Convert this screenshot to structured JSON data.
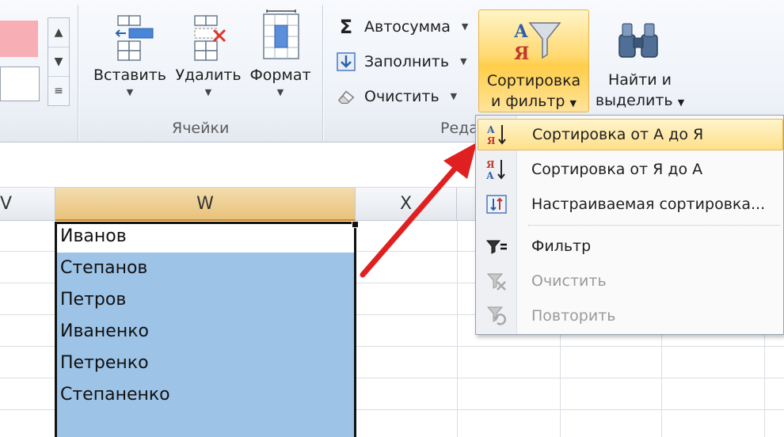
{
  "ribbon": {
    "cells_group": {
      "label": "Ячейки",
      "insert_label": "Вставить",
      "delete_label": "Удалить",
      "format_label": "Формат"
    },
    "editing_group": {
      "label_partial": "Реда",
      "autosum_label": "Автосумма",
      "fill_label": "Заполнить",
      "clear_label": "Очистить",
      "sort_label_line1": "Сортировка",
      "sort_label_line2": "и фильтр",
      "find_label_line1": "Найти и",
      "find_label_line2": "выделить"
    }
  },
  "grid": {
    "columns": [
      "V",
      "W",
      "X"
    ],
    "cells": [
      "Иванов",
      "Степанов",
      "Петров",
      "Иваненко",
      "Петренко",
      "Степаненко"
    ]
  },
  "sort_menu": {
    "items": [
      {
        "label": "Сортировка от А до Я",
        "icon": "sort-a-to-z-icon",
        "state": "hover"
      },
      {
        "label": "Сортировка от Я до А",
        "icon": "sort-z-to-a-icon",
        "state": "normal"
      },
      {
        "label": "Настраиваемая сортировка...",
        "icon": "custom-sort-icon",
        "state": "normal"
      },
      {
        "label": "Фильтр",
        "icon": "filter-icon",
        "state": "normal"
      },
      {
        "label": "Очистить",
        "icon": "clear-filter-icon",
        "state": "disabled"
      },
      {
        "label": "Повторить",
        "icon": "reapply-filter-icon",
        "state": "disabled"
      }
    ]
  },
  "colors": {
    "selection_fill": "#9dc3e6",
    "annotation_arrow": "#e02020",
    "active_button": "#ffd972"
  }
}
